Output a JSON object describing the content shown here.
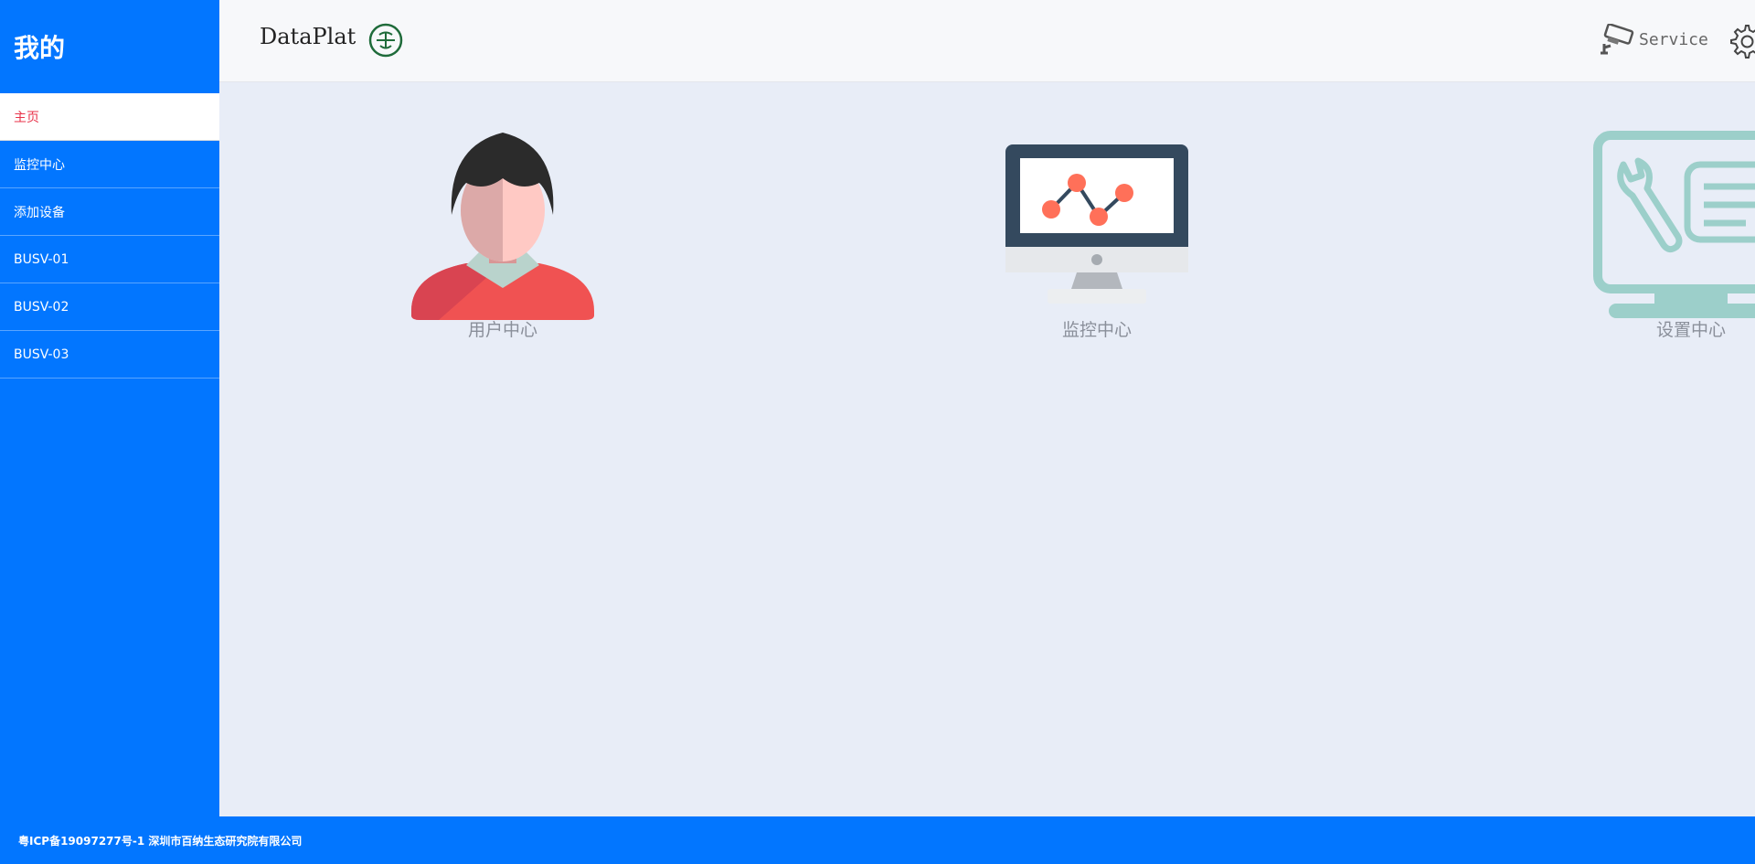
{
  "sidebar": {
    "title": "我的",
    "items": [
      {
        "label": "主页"
      },
      {
        "label": "监控中心"
      },
      {
        "label": "添加设备"
      },
      {
        "label": "BUSV-01"
      },
      {
        "label": "BUSV-02"
      },
      {
        "label": "BUSV-03"
      }
    ]
  },
  "header": {
    "app_name": "DataPlat",
    "logo_icon": "leaf-seal-icon",
    "service_label": "Service",
    "service_icon": "cctv-camera-icon",
    "settings_icon": "gear-icon"
  },
  "main": {
    "cards": [
      {
        "label": "用户中心",
        "icon": "user-avatar-icon"
      },
      {
        "label": "监控中心",
        "icon": "monitor-chart-icon"
      },
      {
        "label": "设置中心",
        "icon": "settings-screen-icon"
      }
    ]
  },
  "footer": {
    "text": "粤ICP备19097277号-1  深圳市百纳生态研究院有限公司"
  },
  "colors": {
    "sidebar_bg": "#0276ff",
    "active_text": "#e8334a",
    "main_bg": "#e8edf7"
  }
}
